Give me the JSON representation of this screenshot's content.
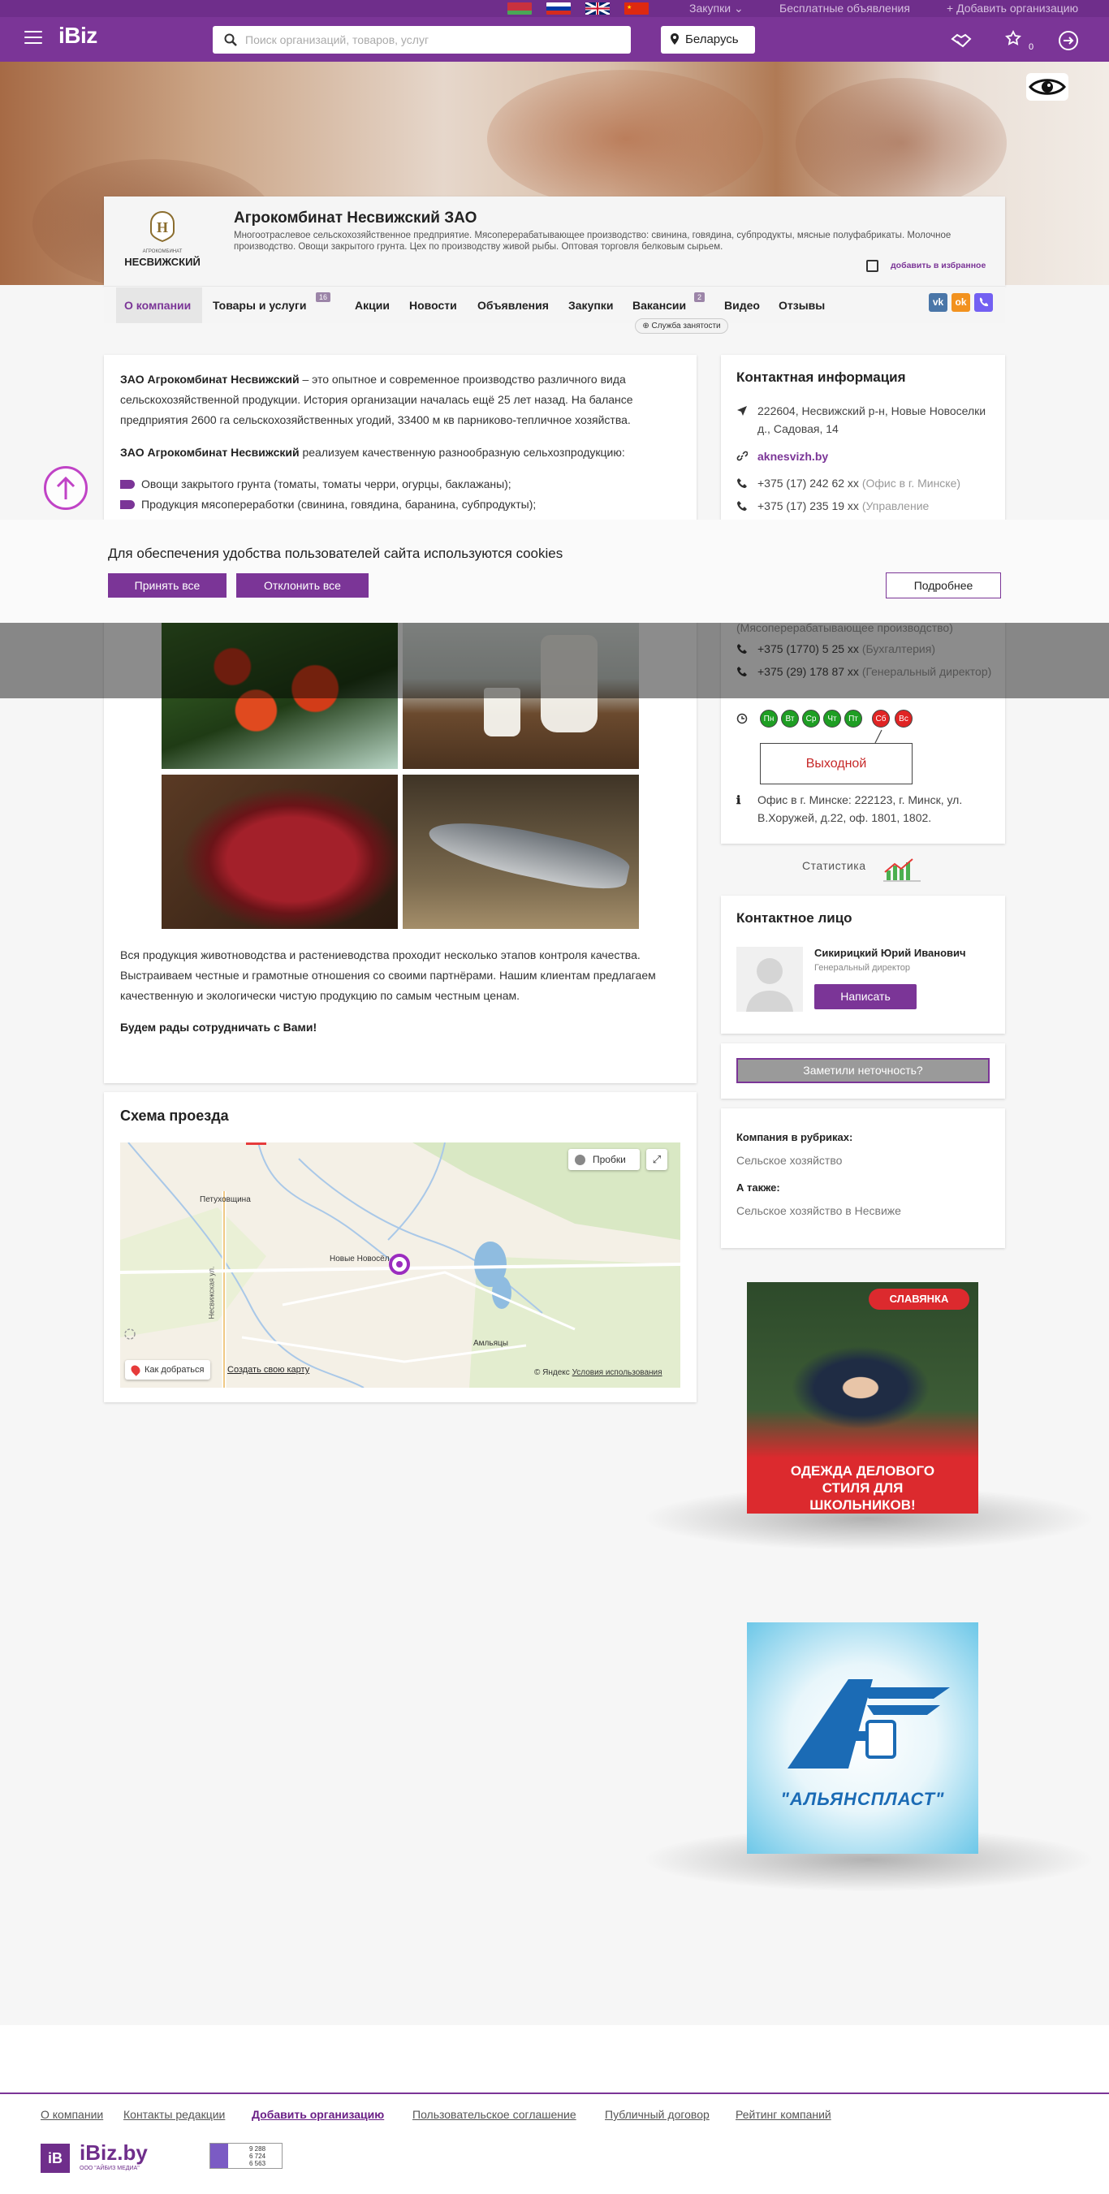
{
  "header": {
    "links": {
      "purchases": "Закупки",
      "free_ads": "Бесплатные объявления",
      "add_org": "Добавить организацию"
    },
    "logo": "iBiz",
    "search_placeholder": "Поиск организаций, товаров, услуг",
    "region": "Беларусь",
    "favorites_count": "0",
    "flags": [
      "by-flag",
      "ru-flag",
      "gb-flag",
      "cn-flag"
    ]
  },
  "company": {
    "title": "Агрокомбинат Несвижский ЗАО",
    "description": "Многоотраслевое сельскохозяйственное предприятие. Мясоперерабатывающее производство: свинина, говядина, субпродукты, мясные полуфабрикаты. Молочное производство. Овощи закрытого грунта. Цех по производству живой рыбы. Оптовая торговля белковым сырьем.",
    "favorite_label": "добавить в избранное",
    "logo_text": "НЕСВИЖСКИЙ",
    "logo_small": "АГРОКОМБИНАТ"
  },
  "tabs": [
    {
      "label": "О компании"
    },
    {
      "label": "Товары и услуги",
      "badge": "16"
    },
    {
      "label": "Акции"
    },
    {
      "label": "Новости"
    },
    {
      "label": "Объявления"
    },
    {
      "label": "Закупки"
    },
    {
      "label": "Вакансии",
      "badge": "2"
    },
    {
      "label": "Видео"
    },
    {
      "label": "Отзывы"
    }
  ],
  "job_pill": "Служба занятости",
  "social": {
    "vk": "vk",
    "ok": "ok",
    "viber": "viber"
  },
  "about": {
    "p1_bold": "ЗАО Агрокомбинат Несвижский",
    "p1_rest": " – это опытное и современное производство различного вида сельскохозяйственной продукции. История организации началась ещё 25 лет назад. На балансе предприятия 2600 га сельскохозяйственных угодий, 33400 м кв парниково-тепличное хозяйства.",
    "p2_bold": "ЗАО Агрокомбинат Несвижский",
    "p2_rest": " реализуем качественную разнообразную сельхозпродукцию:",
    "list": [
      "Овощи закрытого грунта (томаты, томаты черри, огурцы, баклажаны);",
      "Продукция мясопереработки (свинина, говядина, баранина, субпродукты);"
    ],
    "p3": "Вся продукция животноводства и растениеводства проходит несколько этапов контроля качества. Выстраиваем честные и грамотные отношения со своими партнёрами. Нашим клиентам предлагаем качественную и экологически чистую продукцию по самым честным ценам.",
    "p4": "Будем рады сотрудничать с Вами!"
  },
  "map": {
    "title": "Схема проезда",
    "traffic": "Пробки",
    "directions": "Как добраться",
    "create_map": "Создать свою карту",
    "copyright": "© Яндекс",
    "terms": "Условия использования",
    "places": [
      "Петуховщина",
      "Новые Новосёл",
      "Амльяцы",
      "Несвижская ул."
    ]
  },
  "contact": {
    "title": "Контактная информация",
    "address": "222604, Несвижский р-н, Новые Новоселки д., Садовая, 14",
    "site": "aknesvizh.by",
    "phones": [
      {
        "num": "+375 (17) 242 62 xx",
        "note": "(Офис в г. Минске)"
      },
      {
        "num": "+375 (17) 235 19 xx",
        "note": "(Управление"
      },
      {
        "num": "",
        "note": "(Мясоперерабатывающее производство)"
      },
      {
        "num": "+375 (1770) 5 25 xx",
        "note": "(Бухгалтерия)"
      },
      {
        "num": "+375 (29) 178 87 xx",
        "note": "(Генеральный директор)"
      }
    ],
    "days": [
      "Пн",
      "Вт",
      "Ср",
      "Чт",
      "Пт",
      "Сб",
      "Вс"
    ],
    "status": "Выходной",
    "office": "Офис в г. Минске: 222123, г. Минск, ул. В.Хоружей, д.22, оф. 1801, 1802."
  },
  "statistics": "Статистика",
  "person": {
    "title": "Контактное лицо",
    "name": "Сикирицкий Юрий Иванович",
    "role": "Генеральный директор",
    "button": "Написать"
  },
  "mistake": "Заметили неточность?",
  "rubrics": {
    "label": "Компания в рубриках:",
    "value": "Сельское хозяйство",
    "also_label": "А также:",
    "also_value": "Сельское хозяйство в Несвиже"
  },
  "banners": {
    "b1_brand": "СЛАВЯНКА",
    "b1_text": "ОДЕЖДА ДЕЛОВОГО СТИЛЯ ДЛЯ ШКОЛЬНИКОВ!",
    "b2_text": "\"АЛЬЯНСПЛАСТ\""
  },
  "cookies": {
    "text": "Для обеспечения удобства пользователей сайта используются cookies",
    "accept": "Принять все",
    "reject": "Отклонить все",
    "more": "Подробнее"
  },
  "footer": {
    "links": [
      "О компании",
      "Контакты редакции",
      "Добавить организацию",
      "Пользовательское соглашение",
      "Публичный договор",
      "Рейтинг компаний"
    ],
    "logo": "iBiz.by",
    "logo_sub": "ООО \"АЙБИЗ МЕДИА\"",
    "logo_icon": "iB",
    "counter": [
      "9 288",
      "6 724",
      "6 563"
    ]
  },
  "colors": {
    "brand": "#7b3597",
    "green_day": "#1e9e23",
    "red_day": "#e02424"
  }
}
